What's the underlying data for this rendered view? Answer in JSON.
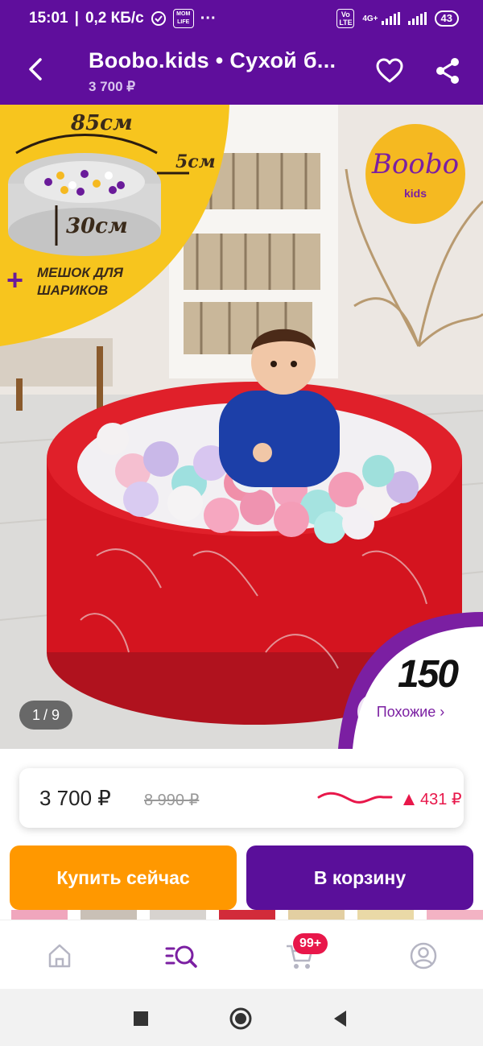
{
  "status_bar": {
    "time": "15:01",
    "speed": "0,2 КБ/с",
    "app_badge": "MOM LIFE",
    "more": "···",
    "volte": "Vo LTE",
    "network": "4G+",
    "battery": "43"
  },
  "header": {
    "title": "Boobo.kids • Сухой б...",
    "price": "3 700 ₽"
  },
  "gallery": {
    "dim_width": "85см",
    "dim_thickness": "5см",
    "dim_height": "30см",
    "bag_line1": "МЕШОК ДЛЯ",
    "bag_line2": "ШАРИКОВ",
    "logo_main": "Boobo",
    "logo_sub": "kids",
    "promo_number": "150",
    "counter_current": "1",
    "counter_total": "/ 9",
    "similar_label": "Похожие ›"
  },
  "price_card": {
    "current": "3 700 ₽",
    "old": "8 990 ₽",
    "change": "431 ₽",
    "change_color": "#e8174a"
  },
  "actions": {
    "buy_now": "Купить сейчас",
    "add_to_cart": "В корзину"
  },
  "bottom_nav": {
    "cart_badge": "99+",
    "items": [
      "home-icon",
      "catalog-search-icon",
      "cart-icon",
      "profile-icon"
    ]
  },
  "colors": {
    "brand_purple": "#5f0e9c",
    "buy_orange": "#ff9800",
    "accent_red": "#e8174a"
  }
}
